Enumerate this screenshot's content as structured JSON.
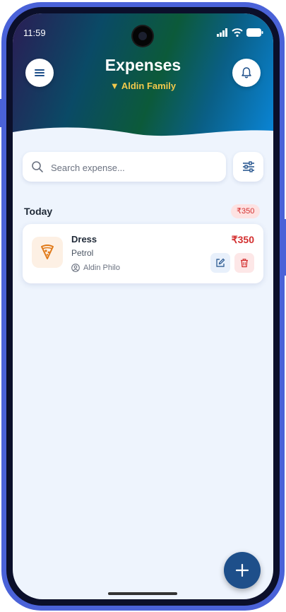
{
  "status_bar": {
    "time": "11:59"
  },
  "header": {
    "title": "Expenses",
    "family_selector": "▼ Aldin Family"
  },
  "search": {
    "placeholder": "Search expense..."
  },
  "section": {
    "title": "Today",
    "total": "₹350"
  },
  "expenses": [
    {
      "name": "Dress",
      "category": "Petrol",
      "user": "Aldin Philo",
      "amount": "₹350",
      "icon": "pizza-slice-icon"
    }
  ],
  "colors": {
    "accent": "#1e4f8a",
    "expense_red": "#d32f2f",
    "family_gold": "#f2c94c",
    "background": "#eef4fd"
  }
}
